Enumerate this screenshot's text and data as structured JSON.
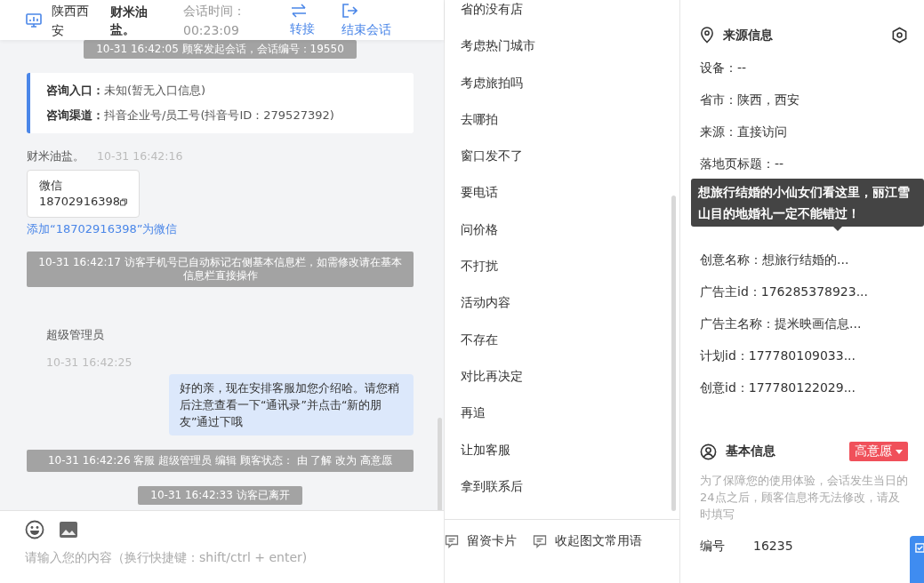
{
  "header": {
    "location": "陕西西安",
    "customer": "财米油盐。",
    "duration_label": "会话时间：",
    "duration": "00:23:09",
    "actions": [
      {
        "kind": "transfer",
        "label": "转接"
      },
      {
        "kind": "end",
        "label": "结束会话"
      }
    ]
  },
  "messages": [
    {
      "kind": "system",
      "text": "10-31 16:42:05 顾客发起会话，会话编号：19550",
      "wide": false
    },
    {
      "kind": "entry_card",
      "rows": [
        {
          "label": "咨询入口：",
          "value": "未知(暂无入口信息)"
        },
        {
          "label": "咨询渠道：",
          "value": "抖音企业号/员工号(抖音号ID：279527392)"
        }
      ]
    },
    {
      "kind": "visitor",
      "sender": "财米油盐。",
      "time": "10-31 16:42:16",
      "card_title": "微信",
      "card_number": "18702916398",
      "link": "添加“18702916398”为微信"
    },
    {
      "kind": "system",
      "text": "10-31 16:42:17 访客手机号已自动标记右侧基本信息栏，如需修改请在基本信息栏直接操作",
      "wide": true
    },
    {
      "kind": "agent",
      "sender": "超级管理员",
      "time": "10-31 16:42:25",
      "text": "好的亲，现在安排客服加您介绍哈。请您稍后注意查看一下“通讯录”并点击“新的朋友”通过下哦"
    },
    {
      "kind": "system",
      "text": "10-31 16:42:26 客服 超级管理员 编辑 顾客状态： 由 了解 改为 高意愿",
      "wide": true
    },
    {
      "kind": "system",
      "text": "10-31 16:42:33 访客已离开",
      "wide": false
    }
  ],
  "input": {
    "placeholder": "请输入您的内容（换行快捷键：shift/ctrl + enter)"
  },
  "phrases": [
    "省的没有店",
    "考虑热门城市",
    "考虑旅拍吗",
    "去哪拍",
    "窗口发不了",
    "要电话",
    "问价格",
    "不打扰",
    "活动内容",
    "不存在",
    "对比再决定",
    "再追",
    "让加客服",
    "拿到联系后"
  ],
  "phrase_actions": [
    "留资卡片",
    "收起图文常用语"
  ],
  "source_info": {
    "title": "来源信息",
    "fields_before": [
      "设备：--",
      "省市：陕西，西安",
      "来源：直接访问",
      "落地页标题：--"
    ],
    "fields_after": [
      "创意名称：想旅行结婚的...",
      "广告主id：176285378923...",
      "广告主名称：提米映画信息...",
      "计划id：177780109033...",
      "创意id：177780122029..."
    ],
    "tooltip": "想旅行结婚的小仙女们看这里，丽江雪山目的地婚礼一定不能错过！"
  },
  "basic_info": {
    "title": "基本信息",
    "intent": "高意愿",
    "notice": "为了保障您的使用体验，会话发生当日的24点之后，顾客信息将无法修改，请及时填写",
    "fields": [
      {
        "label": "编号",
        "value": "16235"
      }
    ]
  }
}
